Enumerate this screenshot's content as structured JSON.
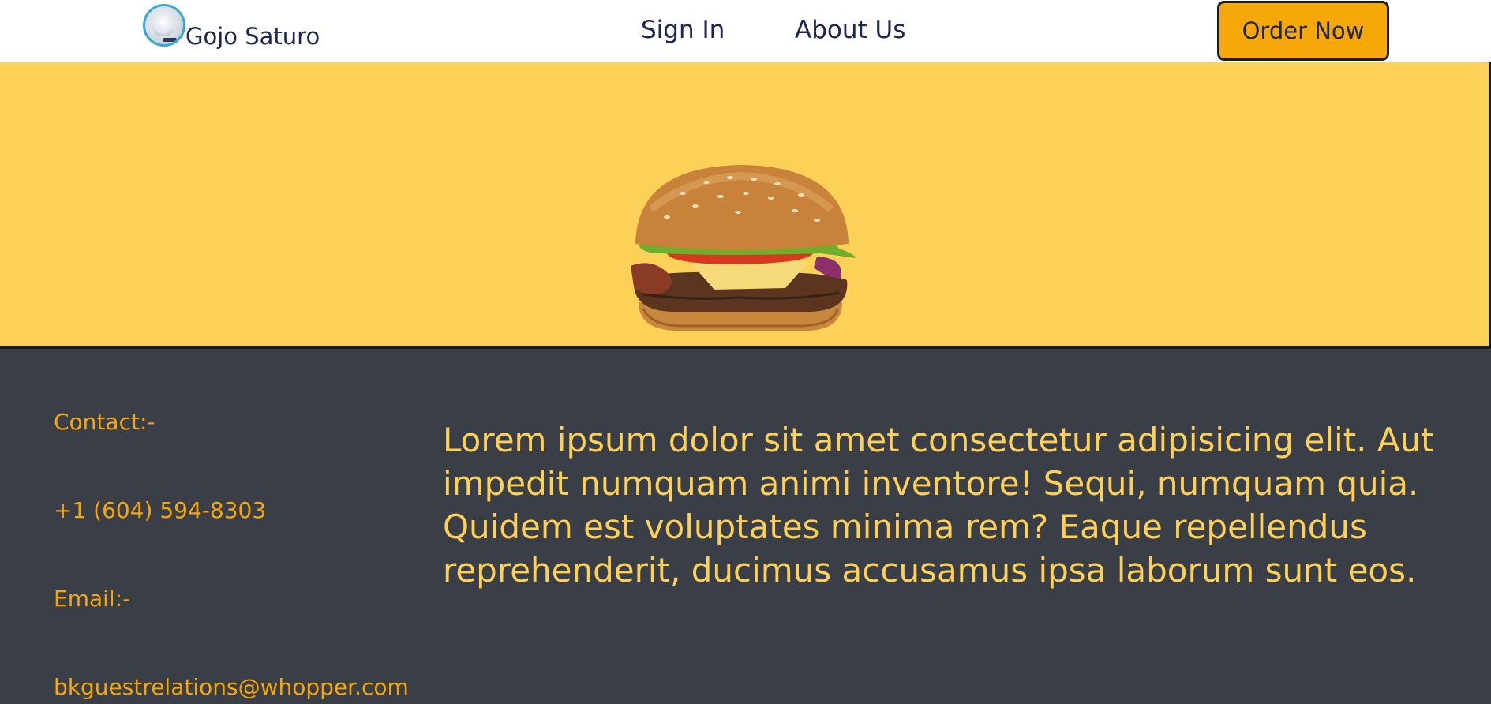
{
  "navbar": {
    "brand_name": "Gojo Saturo",
    "links": [
      {
        "label": "Sign In"
      },
      {
        "label": "About Us"
      }
    ],
    "order_button_label": "Order Now"
  },
  "hero": {
    "image": "burger-image"
  },
  "footer": {
    "contact_heading": "Contact:-",
    "phone": "+1 (604) 594-8303",
    "email_heading": "Email:-",
    "email": "bkguestrelations@whopper.com",
    "description": "Lorem ipsum dolor sit amet consectetur adipisicing elit. Aut impedit numquam animi inventore! Sequi, numquam quia. Quidem est voluptates minima rem? Eaque repellendus reprehenderit, ducimus accusamus ipsa laborum sunt eos."
  },
  "colors": {
    "accent_orange": "#f6a70a",
    "hero_yellow": "#fdd058",
    "footer_dark": "#3a3e46",
    "nav_text": "#1d2551"
  }
}
